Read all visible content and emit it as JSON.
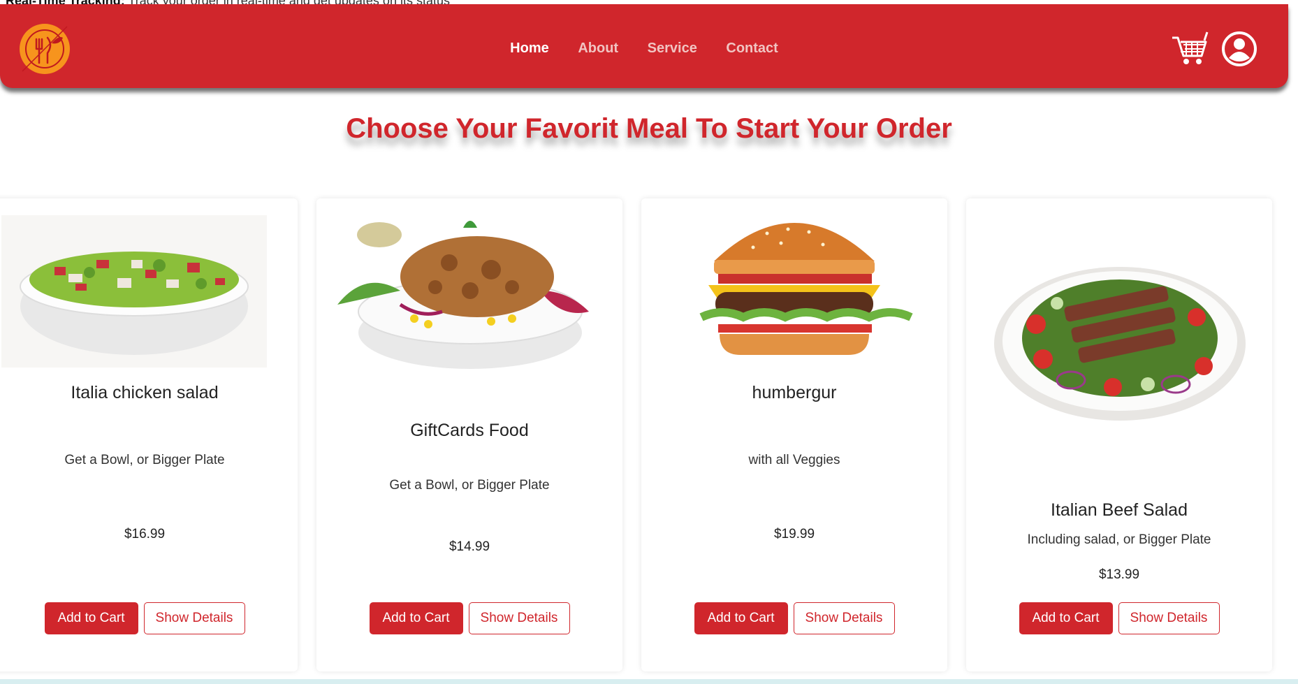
{
  "top_banner": {
    "bold": "Real-Time Tracking:",
    "text": "Track your order in real-time and get updates on its status"
  },
  "nav": {
    "links": [
      {
        "label": "Home",
        "active": true
      },
      {
        "label": "About",
        "active": false
      },
      {
        "label": "Service",
        "active": false
      },
      {
        "label": "Contact",
        "active": false
      }
    ]
  },
  "headline": "Choose Your Favorit Meal To Start Your Order",
  "cards": [
    {
      "name": "Italia chicken salad",
      "description": "Get a Bowl, or Bigger Plate",
      "price": "$16.99",
      "add_label": "Add to Cart",
      "details_label": "Show Details"
    },
    {
      "name": "GiftCards Food",
      "description": "Get a Bowl, or Bigger Plate",
      "price": "$14.99",
      "add_label": "Add to Cart",
      "details_label": "Show Details"
    },
    {
      "name": "humbergur",
      "description": "with all Veggies",
      "price": "$19.99",
      "add_label": "Add to Cart",
      "details_label": "Show Details"
    },
    {
      "name": "Italian Beef Salad",
      "description": "Including salad, or Bigger Plate",
      "price": "$13.99",
      "add_label": "Add to Cart",
      "details_label": "Show Details"
    }
  ],
  "colors": {
    "brand": "#d0262c",
    "nav_inactive": "#f1c4c2",
    "logo_orange": "#f7941d"
  },
  "icons": [
    "logo-icon",
    "cart-icon",
    "user-icon"
  ]
}
